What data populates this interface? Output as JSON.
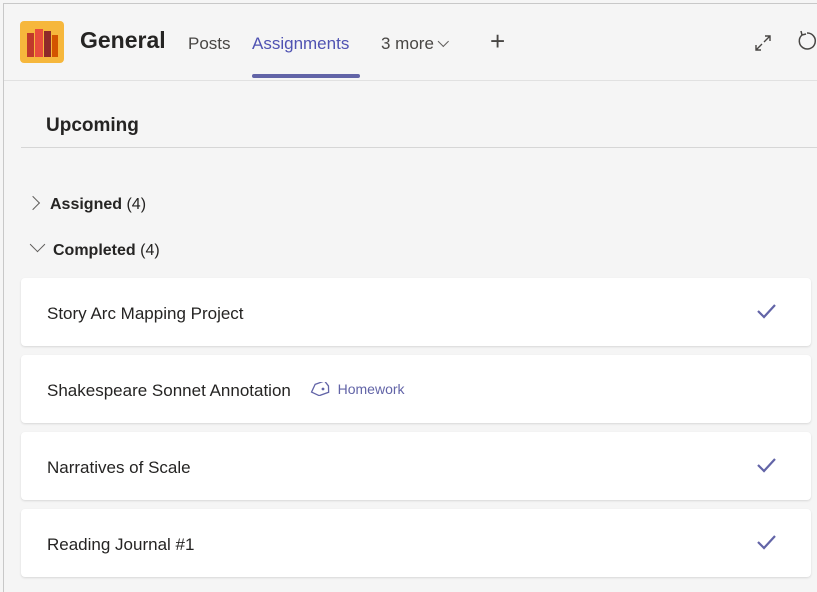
{
  "header": {
    "team_name": "General",
    "tabs": [
      {
        "label": "Posts"
      },
      {
        "label": "Assignments"
      },
      {
        "label": "3 more"
      }
    ]
  },
  "upcoming": {
    "title": "Upcoming"
  },
  "groups": {
    "assigned": {
      "label": "Assigned",
      "count": "(4)"
    },
    "completed": {
      "label": "Completed",
      "count": "(4)"
    }
  },
  "completed_items": [
    {
      "title": "Story Arc Mapping Project",
      "tag": "",
      "checked": true
    },
    {
      "title": "Shakespeare Sonnet Annotation",
      "tag": "Homework",
      "checked": false
    },
    {
      "title": "Narratives of Scale",
      "tag": "",
      "checked": true
    },
    {
      "title": "Reading Journal #1",
      "tag": "",
      "checked": true
    }
  ],
  "colors": {
    "accent": "#6264a7",
    "background": "#f5f5f5",
    "card": "#ffffff"
  }
}
